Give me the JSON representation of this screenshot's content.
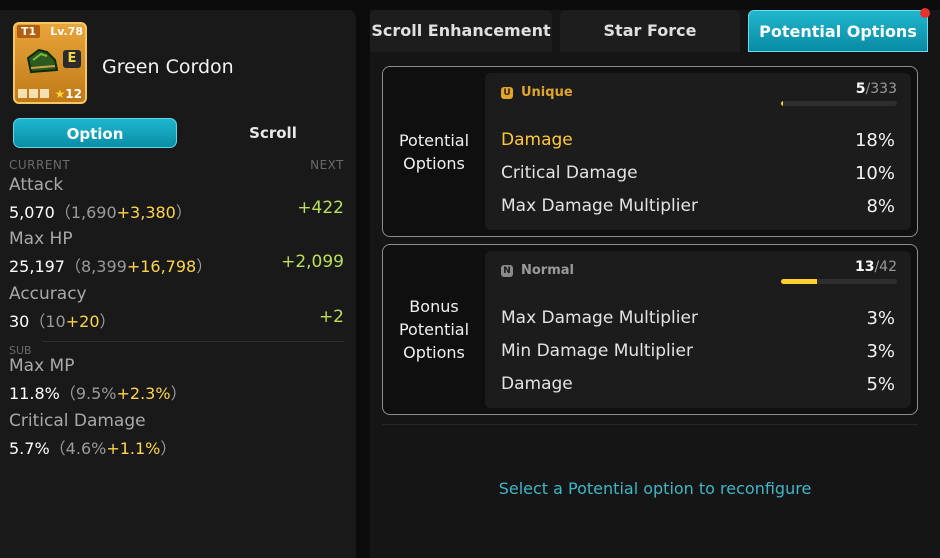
{
  "item": {
    "tier": "T1",
    "level": "Lv.78",
    "grade_letter": "E",
    "stars": "12",
    "name": "Green Cordon"
  },
  "left_tabs": {
    "option": "Option",
    "scroll": "Scroll"
  },
  "columns": {
    "current": "CURRENT",
    "next": "NEXT"
  },
  "stats": [
    {
      "label": "Attack",
      "value": "5,070",
      "base": "1,690",
      "bonus": "+3,380",
      "next": "+422"
    },
    {
      "label": "Max HP",
      "value": "25,197",
      "base": "8,399",
      "bonus": "+16,798",
      "next": "+2,099"
    },
    {
      "label": "Accuracy",
      "value": "30",
      "base": "10",
      "bonus": "+20",
      "next": "+2"
    }
  ],
  "sub_header": "SUB",
  "sub_stats": [
    {
      "label": "Max MP",
      "value": "11.8%",
      "base": "9.5%",
      "bonus": "+2.3%"
    },
    {
      "label": "Critical Damage",
      "value": "5.7%",
      "base": "4.6%",
      "bonus": "+1.1%"
    }
  ],
  "tabs": {
    "scroll_enhancement": "Scroll Enhancement",
    "star_force": "Star Force",
    "potential_options": "Potential Options"
  },
  "potential": {
    "label": "Potential Options",
    "grade_icon": "U",
    "grade": "Unique",
    "grade_color": "#e0a52a",
    "count": "5",
    "count_max": "/333",
    "progress": 0.015,
    "options": [
      {
        "name": "Damage",
        "value": "18%"
      },
      {
        "name": "Critical Damage",
        "value": "10%"
      },
      {
        "name": "Max Damage Multiplier",
        "value": "8%"
      }
    ]
  },
  "bonus": {
    "label": "Bonus Potential Options",
    "grade_icon": "N",
    "grade": "Normal",
    "grade_color": "#9a9a9a",
    "count": "13",
    "count_max": "/42",
    "progress": 0.31,
    "options": [
      {
        "name": "Max Damage Multiplier",
        "value": "3%"
      },
      {
        "name": "Min Damage Multiplier",
        "value": "3%"
      },
      {
        "name": "Damage",
        "value": "5%"
      }
    ]
  },
  "hint": "Select a Potential option to reconfigure"
}
